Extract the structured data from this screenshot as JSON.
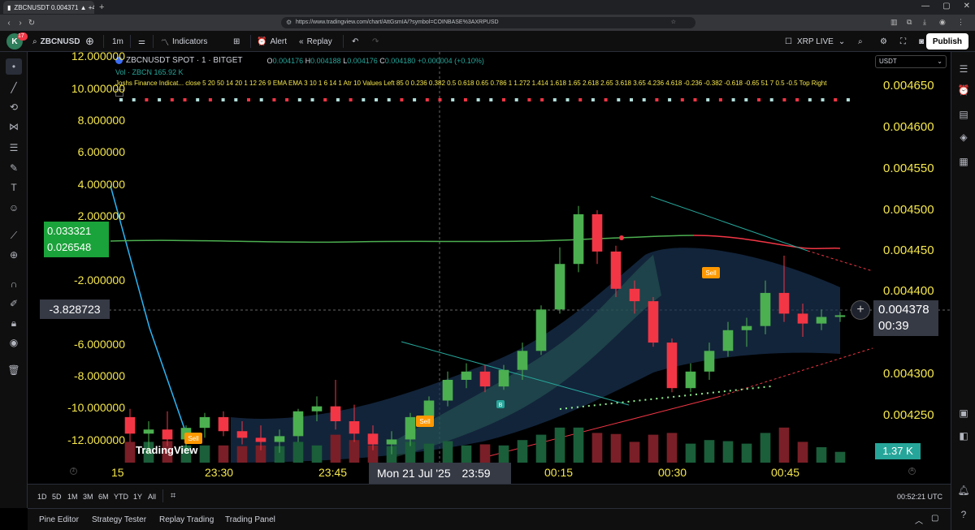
{
  "browser": {
    "tab_title": "ZBCNUSDT 0.004371 ▲ +4.57%",
    "url": "https://www.tradingview.com/chart/AttGsmIA/?symbol=COINBASE%3AXRPUSD"
  },
  "toolbar": {
    "symbol": "ZBCNUSD",
    "interval": "1m",
    "indicators_label": "Indicators",
    "alert_label": "Alert",
    "replay_label": "Replay",
    "watch_symbol": "XRP LIVE",
    "publish_label": "Publish",
    "notification_count": "17",
    "avatar_letter": "K"
  },
  "legend": {
    "symbol_line": "ZBCNUSDT SPOT · 1 · BITGET",
    "open_label": "O",
    "open": "0.004176",
    "high_label": "H",
    "high": "0.004188",
    "low_label": "L",
    "low": "0.004176",
    "close_label": "C",
    "close": "0.004180",
    "change": "+0.000004 (+0.10%)",
    "vol_line": "Vol · ZBCN  165.92 K",
    "indicator_line": "Joshs Finance Indicat...  close 5 20 50 14 20 1 12 26 9 EMA EMA 3 10 1 6 14 1 Atr 10 Values Left 85 0 0.236 0.382 0.5 0.618 0.65 0.786 1 1.272 1.414 1.618 1.65 2.618 2.65 3.618 3.65 4.236 4.618 -0.236 -0.382 -0.618 -0.65 51 7 0.5 -0.5 Top Right"
  },
  "left_scale": {
    "ticks": [
      "12.000000",
      "10.000000",
      "8.000000",
      "6.000000",
      "4.000000",
      "2.000000",
      "-2.000000",
      "-6.000000",
      "-8.000000",
      "-10.000000",
      "-12.000000"
    ],
    "green_box_1": "0.033321",
    "green_box_2": "0.026548",
    "crosshair_value": "-3.828723"
  },
  "right_scale": {
    "currency": "USDT",
    "ticks": [
      "0.004650",
      "0.004600",
      "0.004550",
      "0.004500",
      "0.004450",
      "0.004400",
      "0.004300",
      "0.004250"
    ],
    "last_price": "0.004378",
    "countdown": "00:39",
    "volume_label": "1.37 K"
  },
  "time_axis": {
    "ticks": [
      "15",
      "23:30",
      "23:45",
      "00:15",
      "00:30",
      "00:45"
    ],
    "crosshair_date": "Mon 21 Jul '25",
    "crosshair_time": "23:59"
  },
  "signals": {
    "sell_1": "Sell",
    "sell_2": "Sell",
    "sell_3": "Sell",
    "buy_b": "B"
  },
  "watermark": "TradingView",
  "range_bar": {
    "ranges": [
      "1D",
      "5D",
      "1M",
      "3M",
      "6M",
      "YTD",
      "1Y",
      "All"
    ],
    "clock": "00:52:21 UTC"
  },
  "bottom_panels": [
    "Pine Editor",
    "Strategy Tester",
    "Replay Trading",
    "Trading Panel"
  ],
  "colors": {
    "up": "#4caf50",
    "down": "#f23645",
    "axis_text": "#f5e74b",
    "green_box": "#1aa33a",
    "crosshair_box": "#363a45",
    "teal_box": "#26a69a"
  },
  "chart_data": {
    "type": "candlestick",
    "symbol": "ZBCNUSDT",
    "interval": "1m",
    "ylim": [
      0.0042,
      0.0047
    ],
    "candles": [
      {
        "t": "23:18",
        "o": 0.004255,
        "h": 0.004265,
        "l": 0.004225,
        "c": 0.004235
      },
      {
        "t": "23:20",
        "o": 0.004235,
        "h": 0.00425,
        "l": 0.00421,
        "c": 0.00424
      },
      {
        "t": "23:23",
        "o": 0.00424,
        "h": 0.004262,
        "l": 0.00422,
        "c": 0.004228
      },
      {
        "t": "23:26",
        "o": 0.004228,
        "h": 0.004245,
        "l": 0.004215,
        "c": 0.004242
      },
      {
        "t": "23:29",
        "o": 0.004242,
        "h": 0.00426,
        "l": 0.00423,
        "c": 0.004255
      },
      {
        "t": "23:32",
        "o": 0.004255,
        "h": 0.004262,
        "l": 0.004232,
        "c": 0.004238
      },
      {
        "t": "23:35",
        "o": 0.004238,
        "h": 0.00425,
        "l": 0.004222,
        "c": 0.00423
      },
      {
        "t": "23:38",
        "o": 0.00423,
        "h": 0.004245,
        "l": 0.004215,
        "c": 0.004225
      },
      {
        "t": "23:41",
        "o": 0.004225,
        "h": 0.00424,
        "l": 0.004212,
        "c": 0.004232
      },
      {
        "t": "23:44",
        "o": 0.004232,
        "h": 0.004265,
        "l": 0.004225,
        "c": 0.004262
      },
      {
        "t": "23:47",
        "o": 0.004262,
        "h": 0.00428,
        "l": 0.00425,
        "c": 0.004268
      },
      {
        "t": "23:50",
        "o": 0.004268,
        "h": 0.0043,
        "l": 0.00424,
        "c": 0.00425
      },
      {
        "t": "23:53",
        "o": 0.00425,
        "h": 0.00427,
        "l": 0.004225,
        "c": 0.004235
      },
      {
        "t": "23:56",
        "o": 0.004235,
        "h": 0.004245,
        "l": 0.004215,
        "c": 0.004222
      },
      {
        "t": "23:59",
        "o": 0.004222,
        "h": 0.004238,
        "l": 0.00421,
        "c": 0.004228
      },
      {
        "t": "00:02",
        "o": 0.004228,
        "h": 0.00426,
        "l": 0.00422,
        "c": 0.004255
      },
      {
        "t": "00:05",
        "o": 0.004255,
        "h": 0.00428,
        "l": 0.004245,
        "c": 0.004275
      },
      {
        "t": "00:08",
        "o": 0.004275,
        "h": 0.00431,
        "l": 0.004268,
        "c": 0.0043
      },
      {
        "t": "00:11",
        "o": 0.0043,
        "h": 0.00432,
        "l": 0.00429,
        "c": 0.00431
      },
      {
        "t": "00:14",
        "o": 0.00431,
        "h": 0.004318,
        "l": 0.004285,
        "c": 0.004292
      },
      {
        "t": "00:17",
        "o": 0.004292,
        "h": 0.004318,
        "l": 0.004288,
        "c": 0.004312
      },
      {
        "t": "00:20",
        "o": 0.004312,
        "h": 0.004345,
        "l": 0.0043,
        "c": 0.004335
      },
      {
        "t": "00:23",
        "o": 0.004335,
        "h": 0.00439,
        "l": 0.00433,
        "c": 0.004385
      },
      {
        "t": "00:25",
        "o": 0.004385,
        "h": 0.00446,
        "l": 0.00438,
        "c": 0.00444
      },
      {
        "t": "00:26",
        "o": 0.00444,
        "h": 0.00451,
        "l": 0.00443,
        "c": 0.0045
      },
      {
        "t": "00:27",
        "o": 0.0045,
        "h": 0.004505,
        "l": 0.00444,
        "c": 0.004455
      },
      {
        "t": "00:29",
        "o": 0.004455,
        "h": 0.004462,
        "l": 0.0044,
        "c": 0.00441
      },
      {
        "t": "00:32",
        "o": 0.00441,
        "h": 0.00442,
        "l": 0.00438,
        "c": 0.004395
      },
      {
        "t": "00:34",
        "o": 0.004395,
        "h": 0.0044,
        "l": 0.00434,
        "c": 0.004345
      },
      {
        "t": "00:36",
        "o": 0.004345,
        "h": 0.00435,
        "l": 0.004285,
        "c": 0.00429
      },
      {
        "t": "00:38",
        "o": 0.00429,
        "h": 0.00432,
        "l": 0.004285,
        "c": 0.00431
      },
      {
        "t": "00:40",
        "o": 0.00431,
        "h": 0.004345,
        "l": 0.0043,
        "c": 0.004335
      },
      {
        "t": "00:42",
        "o": 0.004335,
        "h": 0.00437,
        "l": 0.004328,
        "c": 0.00436
      },
      {
        "t": "00:44",
        "o": 0.00436,
        "h": 0.004375,
        "l": 0.00434,
        "c": 0.004365
      },
      {
        "t": "00:46",
        "o": 0.004365,
        "h": 0.00442,
        "l": 0.004355,
        "c": 0.004405
      },
      {
        "t": "00:47",
        "o": 0.004405,
        "h": 0.00445,
        "l": 0.00437,
        "c": 0.00438
      },
      {
        "t": "00:49",
        "o": 0.00438,
        "h": 0.004392,
        "l": 0.004352,
        "c": 0.004368
      },
      {
        "t": "00:51",
        "o": 0.004368,
        "h": 0.004385,
        "l": 0.00436,
        "c": 0.004376
      },
      {
        "t": "00:52",
        "o": 0.004376,
        "h": 0.004382,
        "l": 0.00437,
        "c": 0.004378
      }
    ]
  }
}
